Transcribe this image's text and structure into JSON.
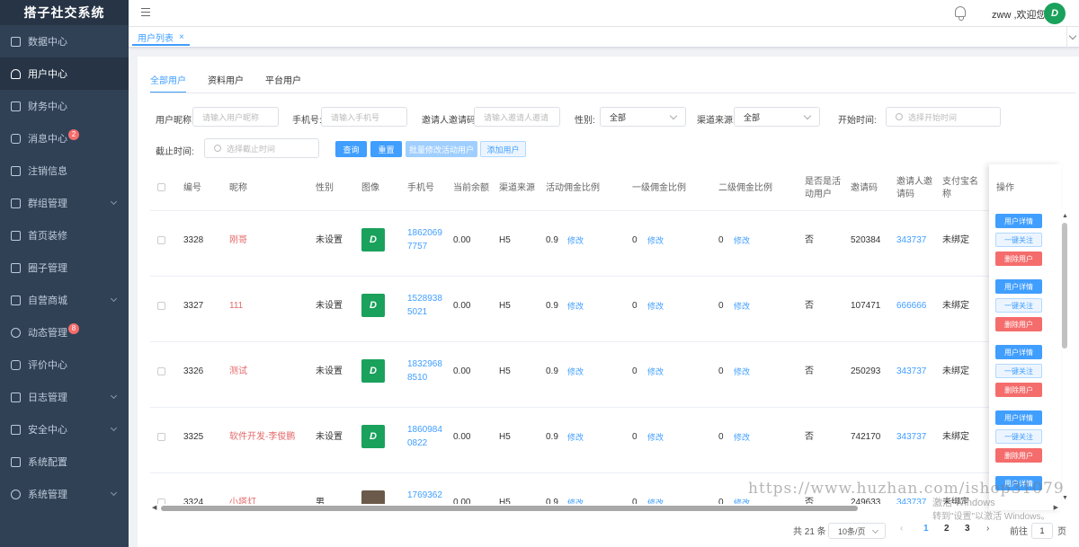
{
  "app": {
    "title": "搭子社交系统"
  },
  "sidebar": {
    "items": [
      {
        "label": "数据中心",
        "icon": "chart-icon",
        "expandable": false,
        "badge": ""
      },
      {
        "label": "用户中心",
        "icon": "user-icon",
        "expandable": false,
        "badge": "",
        "active": true
      },
      {
        "label": "财务中心",
        "icon": "wallet-icon",
        "expandable": false,
        "badge": ""
      },
      {
        "label": "消息中心",
        "icon": "message-icon",
        "expandable": false,
        "badge": "2"
      },
      {
        "label": "注销信息",
        "icon": "document-icon",
        "expandable": false,
        "badge": ""
      },
      {
        "label": "群组管理",
        "icon": "grid-icon",
        "expandable": true,
        "badge": ""
      },
      {
        "label": "首页装修",
        "icon": "cube-icon",
        "expandable": false,
        "badge": ""
      },
      {
        "label": "圈子管理",
        "icon": "board-icon",
        "expandable": false,
        "badge": ""
      },
      {
        "label": "自营商城",
        "icon": "shop-icon",
        "expandable": true,
        "badge": ""
      },
      {
        "label": "动态管理",
        "icon": "pie-icon",
        "expandable": false,
        "badge": "8"
      },
      {
        "label": "评价中心",
        "icon": "comment-icon",
        "expandable": false,
        "badge": ""
      },
      {
        "label": "日志管理",
        "icon": "calendar-icon",
        "expandable": true,
        "badge": ""
      },
      {
        "label": "安全中心",
        "icon": "shield-icon",
        "expandable": true,
        "badge": ""
      },
      {
        "label": "系统配置",
        "icon": "list-icon",
        "expandable": false,
        "badge": ""
      },
      {
        "label": "系统管理",
        "icon": "gear-icon",
        "expandable": true,
        "badge": ""
      }
    ]
  },
  "topbar": {
    "welcome": "zww ,欢迎您",
    "avatar_text": "D"
  },
  "tabs": {
    "current": "用户列表",
    "close": "×"
  },
  "subtabs": [
    "全部用户",
    "资料用户",
    "平台用户"
  ],
  "filters": {
    "nickname_label": "用户昵称:",
    "nickname_placeholder": "请输入用户昵称",
    "phone_label": "手机号:",
    "phone_placeholder": "请输入手机号",
    "invite_label": "邀请人邀请码:",
    "invite_placeholder": "请输入邀请人邀请",
    "gender_label": "性别:",
    "gender_value": "全部",
    "channel_label": "渠道来源:",
    "channel_value": "全部",
    "start_label": "开始时间:",
    "start_placeholder": "选择开始时间",
    "end_label": "截止时间:",
    "end_placeholder": "选择截止时间"
  },
  "buttons": {
    "query": "查询",
    "reset": "重置",
    "batch": "批量修改活动用户",
    "add": "添加用户"
  },
  "table": {
    "headers": {
      "id": "编号",
      "nickname": "昵称",
      "gender": "性别",
      "image": "图像",
      "phone": "手机号",
      "balance": "当前余额",
      "channel": "渠道来源",
      "activity_ratio": "活动佣金比例",
      "level1": "一级佣金比例",
      "level2": "二级佣金比例",
      "is_activity": "是否是活动用户",
      "invite_code": "邀请码",
      "inviter_code": "邀请人邀请码",
      "alipay": "支付宝名称",
      "ops": "操作"
    },
    "modify": "修改",
    "rows": [
      {
        "id": "3328",
        "nickname": "刚哥",
        "gender": "未设置",
        "phone": "18620697757",
        "phone_a": "1862069",
        "phone_b": "7757",
        "balance": "0.00",
        "channel": "H5",
        "activity_ratio": "0.9",
        "level1": "0",
        "level2": "0",
        "is_activity": "否",
        "invite_code": "520384",
        "inviter_code": "343737",
        "alipay": "未绑定"
      },
      {
        "id": "3327",
        "nickname": "111",
        "gender": "未设置",
        "phone": "15289385021",
        "phone_a": "1528938",
        "phone_b": "5021",
        "balance": "0.00",
        "channel": "H5",
        "activity_ratio": "0.9",
        "level1": "0",
        "level2": "0",
        "is_activity": "否",
        "invite_code": "107471",
        "inviter_code": "666666",
        "alipay": "未绑定"
      },
      {
        "id": "3326",
        "nickname": "测试",
        "gender": "未设置",
        "phone": "18329688510",
        "phone_a": "1832968",
        "phone_b": "8510",
        "balance": "0.00",
        "channel": "H5",
        "activity_ratio": "0.9",
        "level1": "0",
        "level2": "0",
        "is_activity": "否",
        "invite_code": "250293",
        "inviter_code": "343737",
        "alipay": "未绑定"
      },
      {
        "id": "3325",
        "nickname": "软件开发-李俊鹏",
        "gender": "未设置",
        "phone": "18609840822",
        "phone_a": "1860984",
        "phone_b": "0822",
        "balance": "0.00",
        "channel": "H5",
        "activity_ratio": "0.9",
        "level1": "0",
        "level2": "0",
        "is_activity": "否",
        "invite_code": "742170",
        "inviter_code": "343737",
        "alipay": "未绑定"
      },
      {
        "id": "3324",
        "nickname": "小塔灯",
        "gender": "男",
        "phone": "1769362",
        "phone_a": "1769362",
        "phone_b": "",
        "balance": "0.00",
        "channel": "H5",
        "activity_ratio": "0.9",
        "level1": "0",
        "level2": "0",
        "is_activity": "否",
        "invite_code": "249633",
        "inviter_code": "343737",
        "alipay": "未绑定"
      }
    ],
    "row_ops": {
      "detail": "用户详情",
      "follow": "一键关注",
      "delete": "删除用户"
    }
  },
  "pagination": {
    "total": "共 21 条",
    "page_size": "10条/页",
    "pages": [
      "1",
      "2",
      "3"
    ],
    "current_page": "1",
    "goto_label": "前往",
    "goto_value": "1",
    "page_suffix": "页"
  },
  "watermark": {
    "url": "https://www.huzhan.com/ishop31079",
    "win_line1": "激活 Windows",
    "win_line2": "转到\"设置\"以激活 Windows。"
  }
}
